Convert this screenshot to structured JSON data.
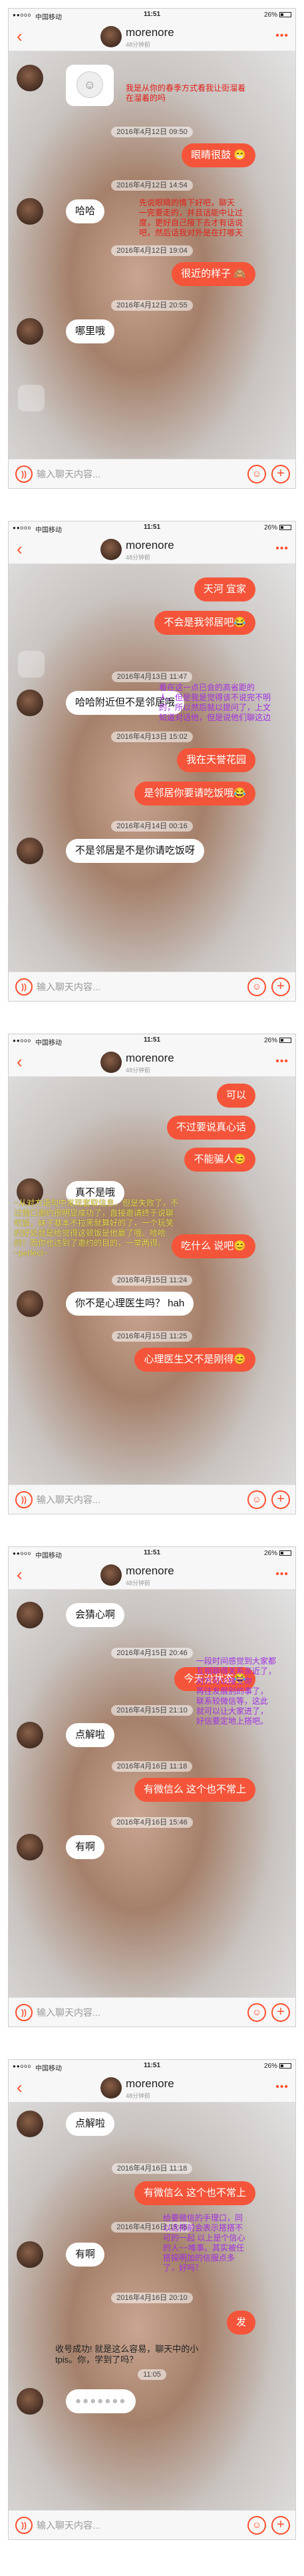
{
  "status": {
    "signal": "●●ooo",
    "carrier": "中国移动",
    "time": "11:51",
    "battery": "26%"
  },
  "nav": {
    "back": "‹",
    "name": "morenore",
    "sub": "48分钟前",
    "more": "•••"
  },
  "input": {
    "voice": "))",
    "placeholder": "输入聊天内容...",
    "emoji": "☺",
    "plus": "+"
  },
  "icons": [
    "back-icon",
    "avatar",
    "more-icon",
    "voice-icon",
    "emoji-icon",
    "plus-icon"
  ],
  "colors": {
    "accent": "#ff5030",
    "outgoing": "#f4553a"
  },
  "p1": {
    "ts1": "2016年4月12日 09:50",
    "note1": "我是从你的春季方式看我让街溜着\n在溜着的吗",
    "m1": "眼睛很鼓 😁",
    "ts2": "2016年4月12日 14:54",
    "m2": "哈哈",
    "note2": "先说眼睛的情下好吧，聊天\n一完要走的，并且话能中让过\n度，更好自己接下去才有话说\n吧，然后话我对外是在打哪天",
    "ts3": "2016年4月12日 19:04",
    "m3": "很近的样子 🙈",
    "ts4": "2016年4月12日 20:55",
    "m4": "哪里哦"
  },
  "p2": {
    "m1": "天河 宜家",
    "m2": "不会是我邻居吧😂",
    "ts1": "2016年4月13日 11:47",
    "m3": "哈哈附近但不是邻居哦",
    "note1": "看在这一点已会的高省距的\n人，但是我是觉得该不说完不明\n的，所以然后就以提问了，上文\n知道对话他，但是说他们聊这边",
    "ts2": "2016年4月13日 15:02",
    "m4": "我在天誉花园",
    "m5": "是邻居你要请吃饭哦😂",
    "ts3": "2016年4月14日 00:16",
    "m6": "不是邻居是不是你请吃饭呀"
  },
  "p3": {
    "m1": "可以",
    "m2": "不过要说真心话",
    "m3": "不能骗人😊",
    "m4": "真不是哦",
    "note1": "~从对方语句中发现套取信息，但是失败了，不\n过借口邀约很明显成功了，直接邀请终于说聊\n吃饭，妹子基本不拉黑就算好的了，一个玩笑\n的好处就是给觉得这顿饭是他赢了哦。哈哈\n的！而你也达到了邀约的目的，一举两得。\n~perfect~",
    "m5": "吃什么 说吧😊",
    "ts1": "2016年4月15日 11:24",
    "m6": "你不是心理医生吗？ hah",
    "ts2": "2016年4月15日 11:25",
    "m7": "心理医生又不是刚得😊"
  },
  "p4": {
    "m1": "会猜心啊",
    "ts1": "2016年4月15日 20:46",
    "m2": "今天没状态😂",
    "ts2": "2016年4月15日 21:10",
    "m3": "点解啦",
    "note1": "一段时间感觉到大家都\n互相聊得关系亲近了，\n对方可以接受你\n再往发展别的事了，\n联系较微信等，这此\n就可以让大家进了，\n好信要定地上搭吧。",
    "ts3": "2016年4月16日 11:18",
    "m4": "有微信么 这个也不常上",
    "ts4": "2016年4月16日 15:46",
    "m5": "有啊"
  },
  "p5": {
    "m1": "点解啦",
    "ts1": "2016年4月16日 11:18",
    "m2": "有微信么 这个也不常上",
    "ts2": "2016年4月16日 15:46",
    "note1": "给要微信的手理口，同\n以选择前会表示搭搭不\n可的一起 以上是个信心\n的人~~唯事。其实被任\n搭探明加的信服点多\n了，好吗？",
    "m3": "有啊",
    "ts3": "2016年4月16日 20:10",
    "m4": "发",
    "note2": "收号成功! 就是这么容易，聊天中的小\ntpis。你，学到了吗？",
    "ts4": "11:05",
    "m5": "●●●●●●●"
  }
}
